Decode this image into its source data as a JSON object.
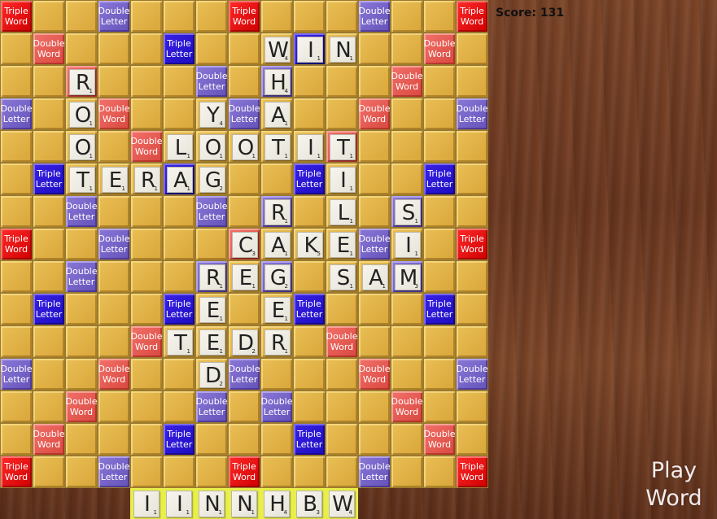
{
  "score": {
    "text": "Score: 131"
  },
  "play_button": {
    "line1": "Play",
    "line2": "Word"
  },
  "premium_labels": {
    "tw": [
      "Triple",
      "Word"
    ],
    "dw": [
      "Double",
      "Word"
    ],
    "tl": [
      "Triple",
      "Letter"
    ],
    "dl": [
      "Double",
      "Letter"
    ]
  },
  "board": {
    "size": 15,
    "premium_rows": [
      "T..d...T...d..T",
      ".D...t...t...D.",
      "..D...d.d...D..",
      "d..D...d...D..d",
      "....D.....D....",
      ".t...t...t...t.",
      "..d...d.d...d..",
      "T..d...D...d..T",
      "..d...d.d...d..",
      ".t...t...t...t.",
      "....D.....D....",
      "d..D...d...D..d",
      "..D...d.d...D..",
      ".D...t...t...D.",
      "T..d...T...d..T"
    ]
  },
  "tiles": [
    {
      "row": 1,
      "col": 8,
      "letter": "W",
      "points": "4"
    },
    {
      "row": 1,
      "col": 9,
      "letter": "I",
      "points": "1"
    },
    {
      "row": 1,
      "col": 10,
      "letter": "N",
      "points": "1"
    },
    {
      "row": 2,
      "col": 2,
      "letter": "R",
      "points": "1"
    },
    {
      "row": 2,
      "col": 8,
      "letter": "H",
      "points": "4"
    },
    {
      "row": 3,
      "col": 2,
      "letter": "O",
      "points": "1"
    },
    {
      "row": 3,
      "col": 6,
      "letter": "Y",
      "points": "4"
    },
    {
      "row": 3,
      "col": 8,
      "letter": "A",
      "points": "1"
    },
    {
      "row": 4,
      "col": 2,
      "letter": "O",
      "points": "1"
    },
    {
      "row": 4,
      "col": 5,
      "letter": "L",
      "points": "1"
    },
    {
      "row": 4,
      "col": 6,
      "letter": "O",
      "points": "1"
    },
    {
      "row": 4,
      "col": 7,
      "letter": "O",
      "points": "1"
    },
    {
      "row": 4,
      "col": 8,
      "letter": "T",
      "points": "1"
    },
    {
      "row": 4,
      "col": 9,
      "letter": "I",
      "points": "1"
    },
    {
      "row": 4,
      "col": 10,
      "letter": "T",
      "points": "1"
    },
    {
      "row": 5,
      "col": 2,
      "letter": "T",
      "points": "1"
    },
    {
      "row": 5,
      "col": 3,
      "letter": "E",
      "points": "1"
    },
    {
      "row": 5,
      "col": 4,
      "letter": "R",
      "points": "1"
    },
    {
      "row": 5,
      "col": 5,
      "letter": "A",
      "points": "1"
    },
    {
      "row": 5,
      "col": 6,
      "letter": "G",
      "points": "2"
    },
    {
      "row": 5,
      "col": 10,
      "letter": "I",
      "points": "1"
    },
    {
      "row": 6,
      "col": 8,
      "letter": "R",
      "points": "1"
    },
    {
      "row": 6,
      "col": 10,
      "letter": "L",
      "points": "1"
    },
    {
      "row": 6,
      "col": 12,
      "letter": "S",
      "points": "1"
    },
    {
      "row": 7,
      "col": 7,
      "letter": "C",
      "points": "3"
    },
    {
      "row": 7,
      "col": 8,
      "letter": "A",
      "points": "1"
    },
    {
      "row": 7,
      "col": 9,
      "letter": "K",
      "points": "5"
    },
    {
      "row": 7,
      "col": 10,
      "letter": "E",
      "points": "1"
    },
    {
      "row": 7,
      "col": 12,
      "letter": "I",
      "points": "1"
    },
    {
      "row": 8,
      "col": 6,
      "letter": "R",
      "points": "1"
    },
    {
      "row": 8,
      "col": 7,
      "letter": "E",
      "points": "1"
    },
    {
      "row": 8,
      "col": 8,
      "letter": "G",
      "points": "2"
    },
    {
      "row": 8,
      "col": 10,
      "letter": "S",
      "points": "1"
    },
    {
      "row": 8,
      "col": 11,
      "letter": "A",
      "points": "1"
    },
    {
      "row": 8,
      "col": 12,
      "letter": "M",
      "points": "3"
    },
    {
      "row": 9,
      "col": 6,
      "letter": "E",
      "points": "1"
    },
    {
      "row": 9,
      "col": 8,
      "letter": "E",
      "points": "1"
    },
    {
      "row": 10,
      "col": 5,
      "letter": "T",
      "points": "1"
    },
    {
      "row": 10,
      "col": 6,
      "letter": "E",
      "points": "1"
    },
    {
      "row": 10,
      "col": 7,
      "letter": "D",
      "points": "2"
    },
    {
      "row": 10,
      "col": 8,
      "letter": "R",
      "points": "1"
    },
    {
      "row": 11,
      "col": 6,
      "letter": "D",
      "points": "2"
    }
  ],
  "rack": [
    {
      "letter": "I",
      "points": "1"
    },
    {
      "letter": "I",
      "points": "1"
    },
    {
      "letter": "N",
      "points": "1"
    },
    {
      "letter": "N",
      "points": "1"
    },
    {
      "letter": "H",
      "points": "4"
    },
    {
      "letter": "B",
      "points": "3"
    },
    {
      "letter": "W",
      "points": "4"
    }
  ]
}
